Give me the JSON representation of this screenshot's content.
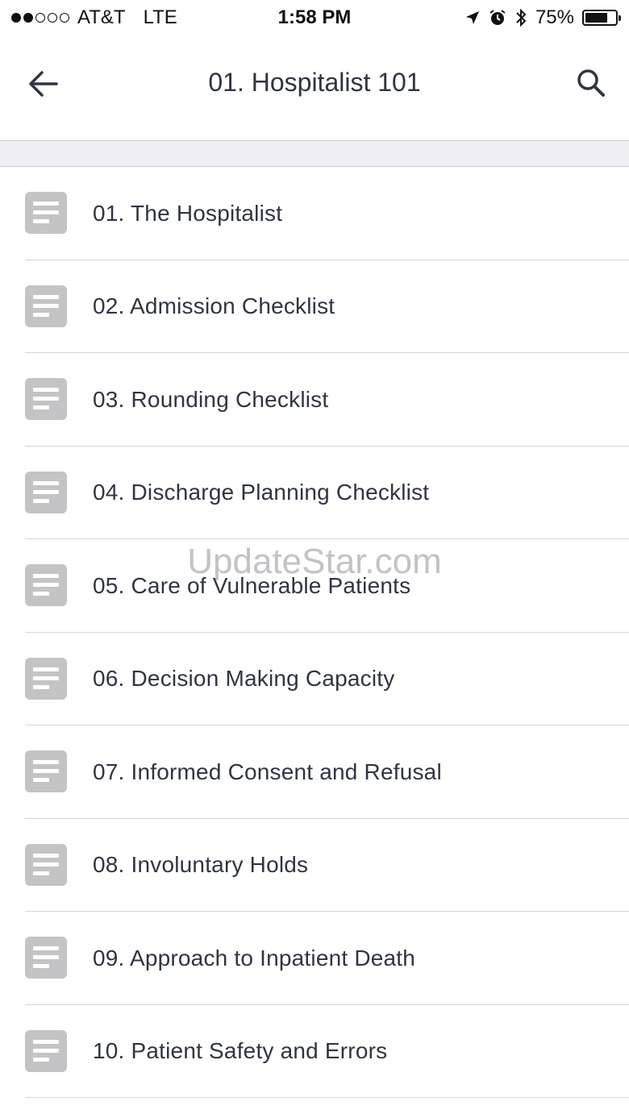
{
  "status_bar": {
    "carrier": "AT&T",
    "network": "LTE",
    "time": "1:58 PM",
    "battery_percent": "75%",
    "battery_level": 0.75,
    "signal_bars_filled": 2,
    "signal_bars_total": 5,
    "icons": [
      "location-arrow-icon",
      "alarm-icon",
      "bluetooth-icon",
      "battery-icon"
    ]
  },
  "nav": {
    "title": "01. Hospitalist 101",
    "back_icon": "arrow-left-icon",
    "search_icon": "search-icon"
  },
  "list": {
    "item_icon": "document-icon",
    "items": [
      {
        "label": "01. The Hospitalist"
      },
      {
        "label": "02. Admission Checklist"
      },
      {
        "label": "03. Rounding Checklist"
      },
      {
        "label": "04. Discharge Planning Checklist"
      },
      {
        "label": "05. Care of Vulnerable Patients"
      },
      {
        "label": "06. Decision Making Capacity"
      },
      {
        "label": "07. Informed Consent and Refusal"
      },
      {
        "label": "08. Involuntary Holds"
      },
      {
        "label": "09. Approach to Inpatient Death"
      },
      {
        "label": "10. Patient Safety and Errors"
      }
    ]
  },
  "watermark": "UpdateStar.com",
  "colors": {
    "text": "#2f3542",
    "icon_bg": "#c4c4c6",
    "separator": "#d5d5d8",
    "band": "#efeff4"
  }
}
